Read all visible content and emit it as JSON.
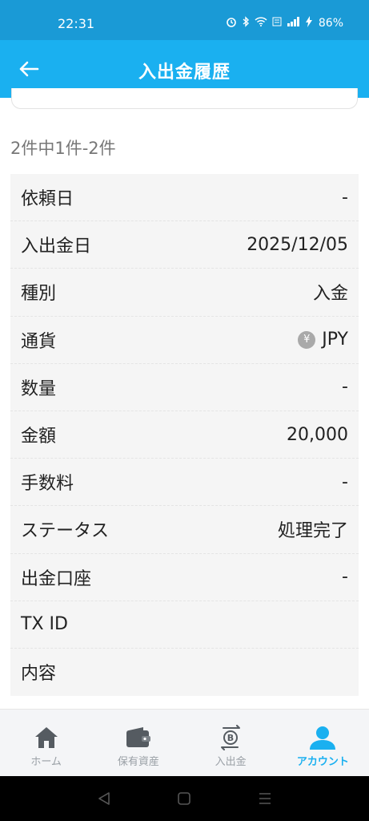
{
  "status_bar": {
    "time": "22:31",
    "battery": "86%"
  },
  "header": {
    "title": "入出金履歴"
  },
  "result_count": "2件中1件-2件",
  "details": {
    "rows": [
      {
        "label": "依頼日",
        "value": "-"
      },
      {
        "label": "入出金日",
        "value": "2025/12/05"
      },
      {
        "label": "種別",
        "value": "入金"
      },
      {
        "label": "通貨",
        "value": "JPY",
        "icon": "yen-icon"
      },
      {
        "label": "数量",
        "value": "-"
      },
      {
        "label": "金額",
        "value": "20,000"
      },
      {
        "label": "手数料",
        "value": "-"
      },
      {
        "label": "ステータス",
        "value": "処理完了"
      },
      {
        "label": "出金口座",
        "value": "-"
      },
      {
        "label": "TX ID",
        "value": ""
      },
      {
        "label": "内容",
        "value": ""
      }
    ]
  },
  "bottom_nav": {
    "items": [
      {
        "label": "ホーム",
        "icon": "home-icon"
      },
      {
        "label": "保有資産",
        "icon": "wallet-icon"
      },
      {
        "label": "入出金",
        "icon": "bitcoin-transfer-icon"
      },
      {
        "label": "アカウント",
        "icon": "person-icon",
        "active": true
      }
    ]
  },
  "colors": {
    "status_bar": "#1a9ad6",
    "header": "#1ab0f0",
    "accent": "#1ab0f0",
    "row_bg": "#f5f5f5"
  }
}
